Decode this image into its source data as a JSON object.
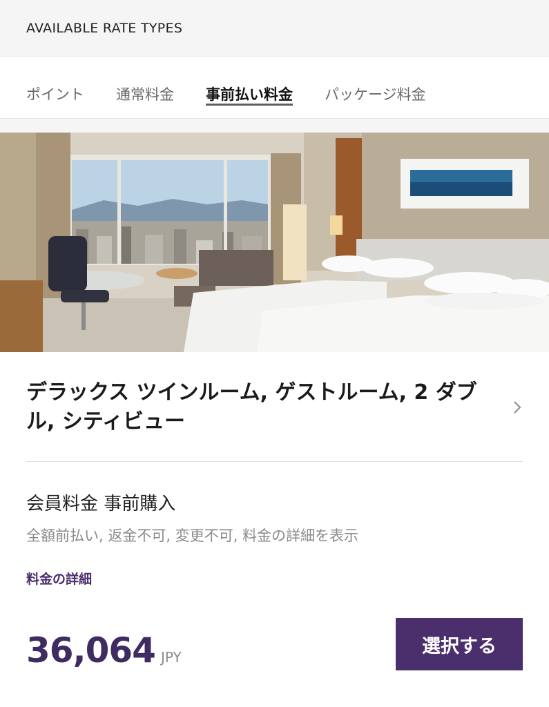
{
  "header": {
    "title": "AVAILABLE RATE TYPES"
  },
  "tabs": [
    {
      "label": "ポイント",
      "active": false
    },
    {
      "label": "通常料金",
      "active": false
    },
    {
      "label": "事前払い料金",
      "active": true
    },
    {
      "label": "パッケージ料金",
      "active": false
    }
  ],
  "room": {
    "title": "デラックス ツインルーム, ゲストルーム, 2 ダブル, シティビュー",
    "chevron_icon": "chevron-right-icon"
  },
  "rate": {
    "name": "会員料金 事前購入",
    "description": "全額前払い, 返金不可,  変更不可, 料金の詳細を表示",
    "details_link": "料金の詳細"
  },
  "price": {
    "amount": "36,064",
    "currency": "JPY"
  },
  "actions": {
    "select_label": "選択する"
  },
  "colors": {
    "accent": "#4b2e6c",
    "price": "#3f2a62"
  }
}
